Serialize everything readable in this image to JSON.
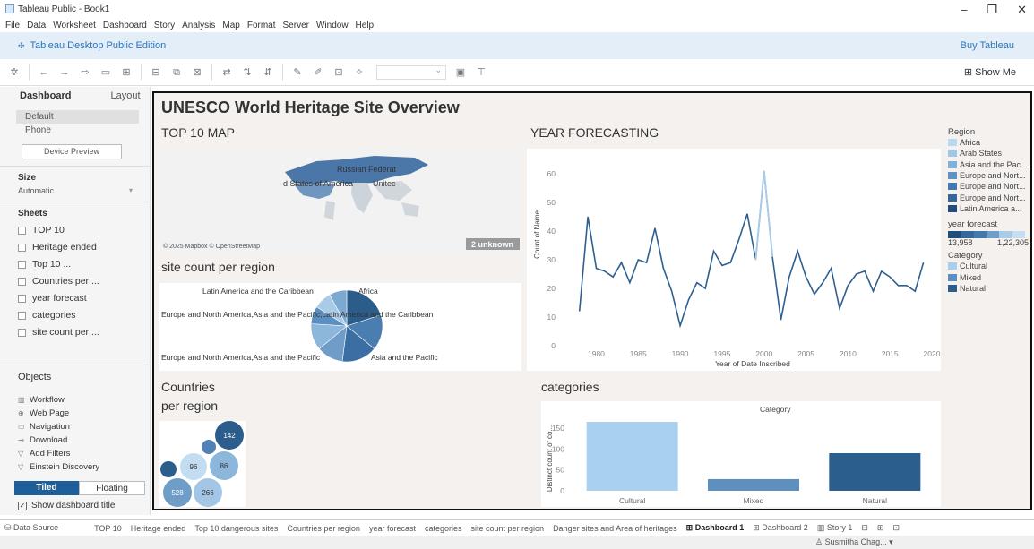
{
  "window": {
    "title": "Tableau Public - Book1"
  },
  "menu": [
    "File",
    "Data",
    "Worksheet",
    "Dashboard",
    "Story",
    "Analysis",
    "Map",
    "Format",
    "Server",
    "Window",
    "Help"
  ],
  "edition": {
    "name": "Tableau Desktop Public Edition",
    "buy": "Buy Tableau"
  },
  "toolbar": {
    "show_me": "Show Me"
  },
  "sidebar": {
    "tabs": {
      "dashboard": "Dashboard",
      "layout": "Layout"
    },
    "devices": [
      "Default",
      "Phone"
    ],
    "device_preview": "Device Preview",
    "size": {
      "heading": "Size",
      "value": "Automatic"
    },
    "sheets_heading": "Sheets",
    "sheets": [
      "TOP 10",
      "Heritage ended",
      "Top 10 ...",
      "Countries per ...",
      "year forecast",
      "categories",
      "site count per ..."
    ],
    "objects_heading": "Objects",
    "objects": [
      "Workflow",
      "Web Page",
      "Navigation",
      "Download",
      "Add Filters",
      "Einstein Discovery"
    ],
    "tiled": "Tiled",
    "floating": "Floating",
    "show_title": "Show dashboard title"
  },
  "dashboard": {
    "title": "UNESCO World Heritage Site Overview",
    "map": {
      "title": "TOP 10 MAP",
      "labels": [
        "Russian Federat",
        "d States of America",
        "Unitec"
      ],
      "attribution": "© 2025 Mapbox © OpenStreetMap",
      "unknown": "2 unknown"
    },
    "pie": {
      "title": "site count per region",
      "labels": [
        "Latin America and the Caribbean",
        "Africa",
        "Europe and North America,Asia and the Pacific,Latin America and the Caribbean",
        "Europe and North America,Asia and the Pacific",
        "Asia and the Pacific"
      ],
      "colors": [
        "#2b5c8a",
        "#4a7eb0",
        "#3b6fa3",
        "#6f9dc7",
        "#8cb6da",
        "#5a8fc0",
        "#a9cbe8",
        "#7ba9d2"
      ]
    },
    "bubbles": {
      "title_line1": "Countries",
      "title_line2": "per region",
      "values": [
        "142",
        "96",
        "86",
        "528",
        "266"
      ]
    },
    "line": {
      "title": "YEAR FORECASTING",
      "ylabel": "Count of Name",
      "xlabel": "Year of Date Inscribed",
      "yticks": [
        "60",
        "50",
        "40",
        "30",
        "20",
        "10",
        "0"
      ],
      "xticks": [
        "1980",
        "1985",
        "1990",
        "1995",
        "2000",
        "2005",
        "2010",
        "2015",
        "2020"
      ]
    },
    "categories": {
      "title": "categories",
      "legend_header": "Category",
      "ylabel": "Distinct count of co...",
      "yticks": [
        "150",
        "100",
        "50",
        "0"
      ]
    }
  },
  "legend": {
    "region_title": "Region",
    "regions": [
      {
        "label": "Africa",
        "color": "#b9d9ef"
      },
      {
        "label": "Arab States",
        "color": "#9fc8e6"
      },
      {
        "label": "Asia and the Pac...",
        "color": "#7fb0da"
      },
      {
        "label": "Europe and Nort...",
        "color": "#5c92c4"
      },
      {
        "label": "Europe and Nort...",
        "color": "#4479ae"
      },
      {
        "label": "Europe and Nort...",
        "color": "#35679b"
      },
      {
        "label": "Latin America a...",
        "color": "#1f4e7c"
      }
    ],
    "forecast_title": "year forecast",
    "forecast_min": "13,958",
    "forecast_max": "1,22,305",
    "category_title": "Category",
    "categories": [
      {
        "label": "Cultural",
        "color": "#a9d0ee"
      },
      {
        "label": "Mixed",
        "color": "#5e8fbf"
      },
      {
        "label": "Natural",
        "color": "#2b5d8d"
      }
    ]
  },
  "chart_data": [
    {
      "type": "line",
      "title": "YEAR FORECASTING",
      "xlabel": "Year of Date Inscribed",
      "ylabel": "Count of Name",
      "ylim": [
        0,
        65
      ],
      "xlim": [
        1976,
        2020
      ],
      "x": [
        1978,
        1979,
        1980,
        1981,
        1982,
        1983,
        1984,
        1985,
        1986,
        1987,
        1988,
        1989,
        1990,
        1991,
        1992,
        1993,
        1994,
        1995,
        1996,
        1997,
        1998,
        1999,
        2000,
        2001,
        2002,
        2003,
        2004,
        2005,
        2006,
        2007,
        2008,
        2009,
        2010,
        2011,
        2012,
        2013,
        2014,
        2015,
        2016,
        2017,
        2018,
        2019
      ],
      "y": [
        12,
        45,
        27,
        26,
        24,
        29,
        22,
        30,
        29,
        41,
        27,
        19,
        7,
        16,
        22,
        20,
        33,
        28,
        29,
        37,
        46,
        30,
        61,
        31,
        9,
        24,
        33,
        24,
        18,
        22,
        27,
        13,
        21,
        25,
        26,
        19,
        26,
        24,
        21,
        21,
        19,
        29
      ],
      "grid": false
    },
    {
      "type": "bar",
      "title": "categories",
      "ylabel": "Distinct count of co...",
      "categories": [
        "Cultural",
        "Mixed",
        "Natural"
      ],
      "values": [
        165,
        28,
        90
      ],
      "ylim": [
        0,
        180
      ],
      "colors": [
        "#a9d0ee",
        "#5e8fbf",
        "#2b5d8d"
      ]
    },
    {
      "type": "pie",
      "title": "site count per region",
      "values": [
        5,
        4,
        4,
        3,
        3,
        2,
        2,
        2
      ]
    }
  ],
  "bottom_tabs": [
    "Data Source",
    "TOP 10",
    "Heritage ended",
    "Top 10 dangerous sites",
    "Countries per region",
    "year forecast",
    "categories",
    "site count per region",
    "Danger sites and Area of heritages",
    "Dashboard 1",
    "Dashboard 2",
    "Story 1"
  ],
  "status": {
    "user": "Susmitha Chag..."
  }
}
